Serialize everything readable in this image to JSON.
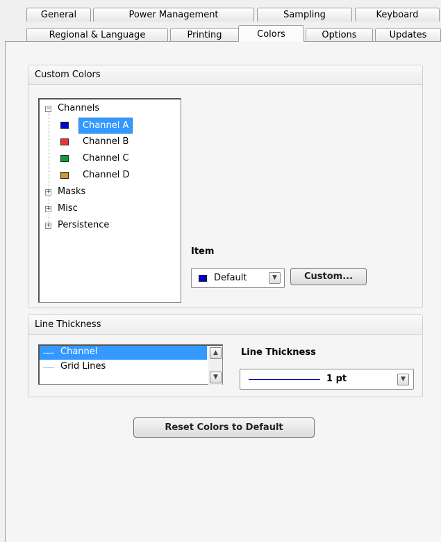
{
  "tabs_row1": [
    {
      "label": "General"
    },
    {
      "label": "Power Management"
    },
    {
      "label": "Sampling"
    },
    {
      "label": "Keyboard"
    }
  ],
  "tabs_row2": [
    {
      "label": "Regional & Language"
    },
    {
      "label": "Printing"
    },
    {
      "label": "Colors",
      "active": true
    },
    {
      "label": "Options"
    },
    {
      "label": "Updates"
    }
  ],
  "custom_colors": {
    "title": "Custom Colors",
    "tree": {
      "channels": {
        "label": "Channels",
        "expanded": true,
        "children": [
          {
            "label": "Channel A",
            "color": "#0000cc",
            "selected": true
          },
          {
            "label": "Channel B",
            "color": "#ee3333"
          },
          {
            "label": "Channel C",
            "color": "#119944"
          },
          {
            "label": "Channel D",
            "color": "#cc9933"
          }
        ]
      },
      "collapsed": [
        {
          "label": "Masks"
        },
        {
          "label": "Misc"
        },
        {
          "label": "Persistence"
        }
      ]
    },
    "item_label": "Item",
    "item_value": "Default",
    "item_color": "#0000cc",
    "custom_button": "Custom..."
  },
  "line_thickness": {
    "title": "Line Thickness",
    "list": [
      {
        "label": "Channel",
        "selected": true,
        "line_color": "#ffffff"
      },
      {
        "label": "Grid Lines",
        "line_color": "#99ccee"
      }
    ],
    "field_label": "Line Thickness",
    "value": "1 pt",
    "preview_color": "#0000aa"
  },
  "reset_button": "Reset Colors to Default",
  "colors": {
    "selection": "#3399ff",
    "panel_bg": "#f5f5f5"
  }
}
